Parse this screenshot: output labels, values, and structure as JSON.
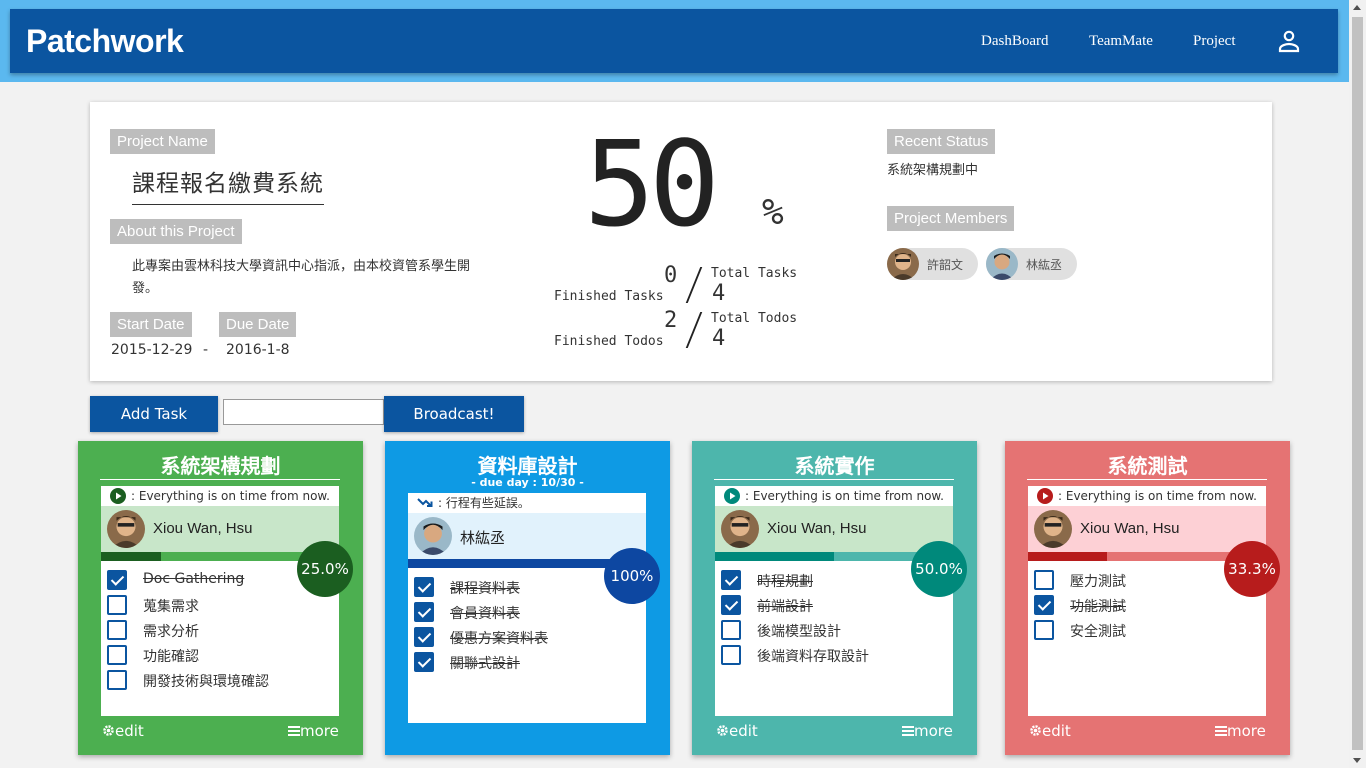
{
  "header": {
    "brand": "Patchwork",
    "nav": [
      "DashBoard",
      "TeamMate",
      "Project"
    ],
    "user_icon": "account-icon"
  },
  "project": {
    "name_label": "Project Name",
    "name": "課程報名繳費系統",
    "about_label": "About this Project",
    "about": "此專案由雲林科技大學資訊中心指派，由本校資管系學生開發。",
    "start_label": "Start Date",
    "start": "2015-12-29",
    "date_sep": "-",
    "due_label": "Due Date",
    "due": "2016-1-8",
    "progress": "50",
    "progress_unit": "%",
    "finished_tasks": "0",
    "finished_tasks_label": "Finished Tasks",
    "total_tasks": "4",
    "total_tasks_label": "Total Tasks",
    "finished_todos": "2",
    "finished_todos_label": "Finished Todos",
    "total_todos": "4",
    "total_todos_label": "Total Todos",
    "recent_status_label": "Recent Status",
    "recent_status": "系統架構規劃中",
    "members_label": "Project Members",
    "members": [
      "許韶文",
      "林紘丞"
    ]
  },
  "actions": {
    "add_task": "Add Task",
    "task_input_value": "",
    "broadcast": "Broadcast!"
  },
  "lists": [
    {
      "title": "系統架構規劃",
      "due": "",
      "color": "#4caf50",
      "status_icon": "play-circle-icon",
      "status": ": Everything is on time from now.",
      "owner": "Xiou Wan, Hsu",
      "progress": 0.25,
      "progress_label": "25.0%",
      "todos": [
        {
          "text": "Doc Gathering",
          "done": true
        },
        {
          "text": "蒐集需求",
          "done": false
        },
        {
          "text": "需求分析",
          "done": false
        },
        {
          "text": "功能確認",
          "done": false
        },
        {
          "text": "開發技術與環境確認",
          "done": false
        }
      ],
      "edit": "edit",
      "more": "more"
    },
    {
      "title": "資料庫設計",
      "due": "- due day : 10/30 -",
      "color": "#0e9ae4",
      "status_icon": "trending-down-icon",
      "status": ": 行程有些延誤。",
      "owner": "林紘丞",
      "progress": 1.0,
      "progress_label": "100%",
      "todos": [
        {
          "text": "課程資料表",
          "done": true
        },
        {
          "text": "會員資料表",
          "done": true
        },
        {
          "text": "優惠方案資料表",
          "done": true
        },
        {
          "text": "關聯式設計",
          "done": true
        }
      ],
      "edit": "",
      "more": ""
    },
    {
      "title": "系統實作",
      "due": "",
      "color": "#4db6ac",
      "status_icon": "play-circle-icon",
      "status": ": Everything is on time from now.",
      "owner": "Xiou Wan, Hsu",
      "progress": 0.5,
      "progress_label": "50.0%",
      "todos": [
        {
          "text": "時程規劃",
          "done": true
        },
        {
          "text": "前端設計",
          "done": true
        },
        {
          "text": "後端模型設計",
          "done": false
        },
        {
          "text": "後端資料存取設計",
          "done": false
        }
      ],
      "edit": "edit",
      "more": "more"
    },
    {
      "title": "系統測試",
      "due": "",
      "color": "#e57373",
      "status_icon": "play-circle-icon",
      "status": ": Everything is on time from now.",
      "owner": "Xiou Wan, Hsu",
      "progress": 0.333,
      "progress_label": "33.3%",
      "todos": [
        {
          "text": "壓力測試",
          "done": false
        },
        {
          "text": "功能測試",
          "done": true
        },
        {
          "text": "安全測試",
          "done": false
        }
      ],
      "edit": "edit",
      "more": "more"
    }
  ]
}
